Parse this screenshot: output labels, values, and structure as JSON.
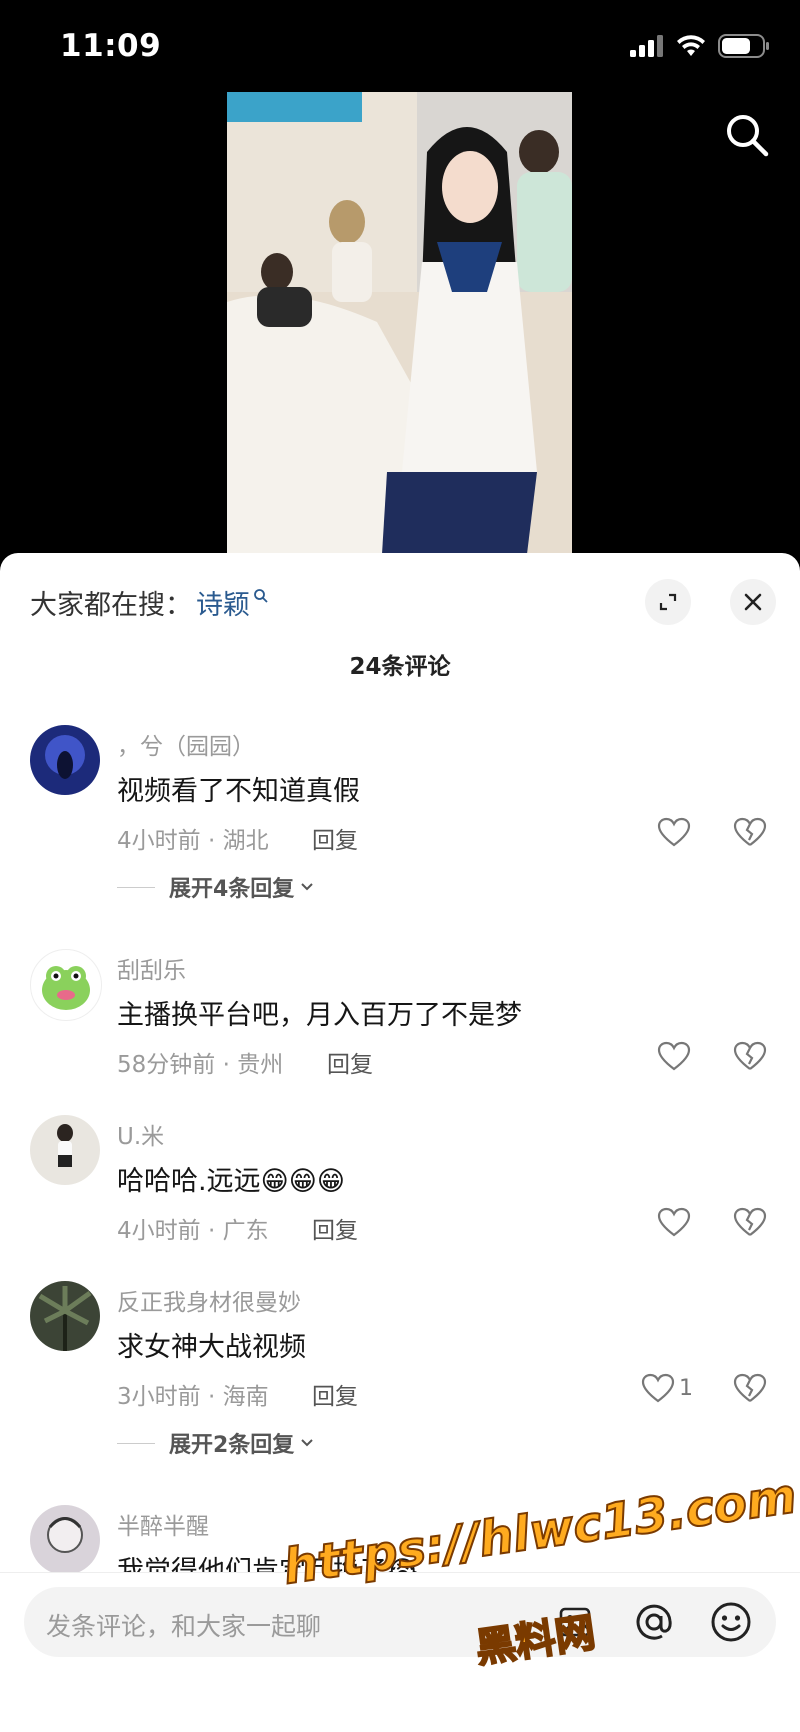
{
  "status": {
    "time": "11:09"
  },
  "sheet": {
    "hot_search_label": "大家都在搜：",
    "hot_search_term": "诗颖",
    "comment_count": "24条评论"
  },
  "comments": [
    {
      "user": "，兮（园园）",
      "text": "视频看了不知道真假",
      "meta": "4小时前 · 湖北",
      "reply": "回复",
      "likes": "",
      "expand": "展开4条回复"
    },
    {
      "user": "刮刮乐",
      "text": "主播换平台吧，月入百万了不是梦",
      "meta": "58分钟前 · 贵州",
      "reply": "回复",
      "likes": "",
      "expand": ""
    },
    {
      "user": "U.米",
      "text": "哈哈哈.远远😁😁😁",
      "meta": "4小时前 · 广东",
      "reply": "回复",
      "likes": "",
      "expand": ""
    },
    {
      "user": "反正我身材很曼妙",
      "text": "求女神大战视频",
      "meta": "3小时前 · 海南",
      "reply": "回复",
      "likes": "1",
      "expand": "展开2条回复"
    },
    {
      "user": "半醉半醒",
      "text": "我觉得他们肯定互换了😭",
      "meta": "",
      "reply": "",
      "likes": "",
      "expand": ""
    }
  ],
  "input": {
    "placeholder": "发条评论，和大家一起聊"
  },
  "watermark": {
    "url": "https://hlwc13.com",
    "name": "黑料网"
  },
  "colors": {
    "link": "#2a5a8f",
    "watermark": "#ffab1f"
  }
}
